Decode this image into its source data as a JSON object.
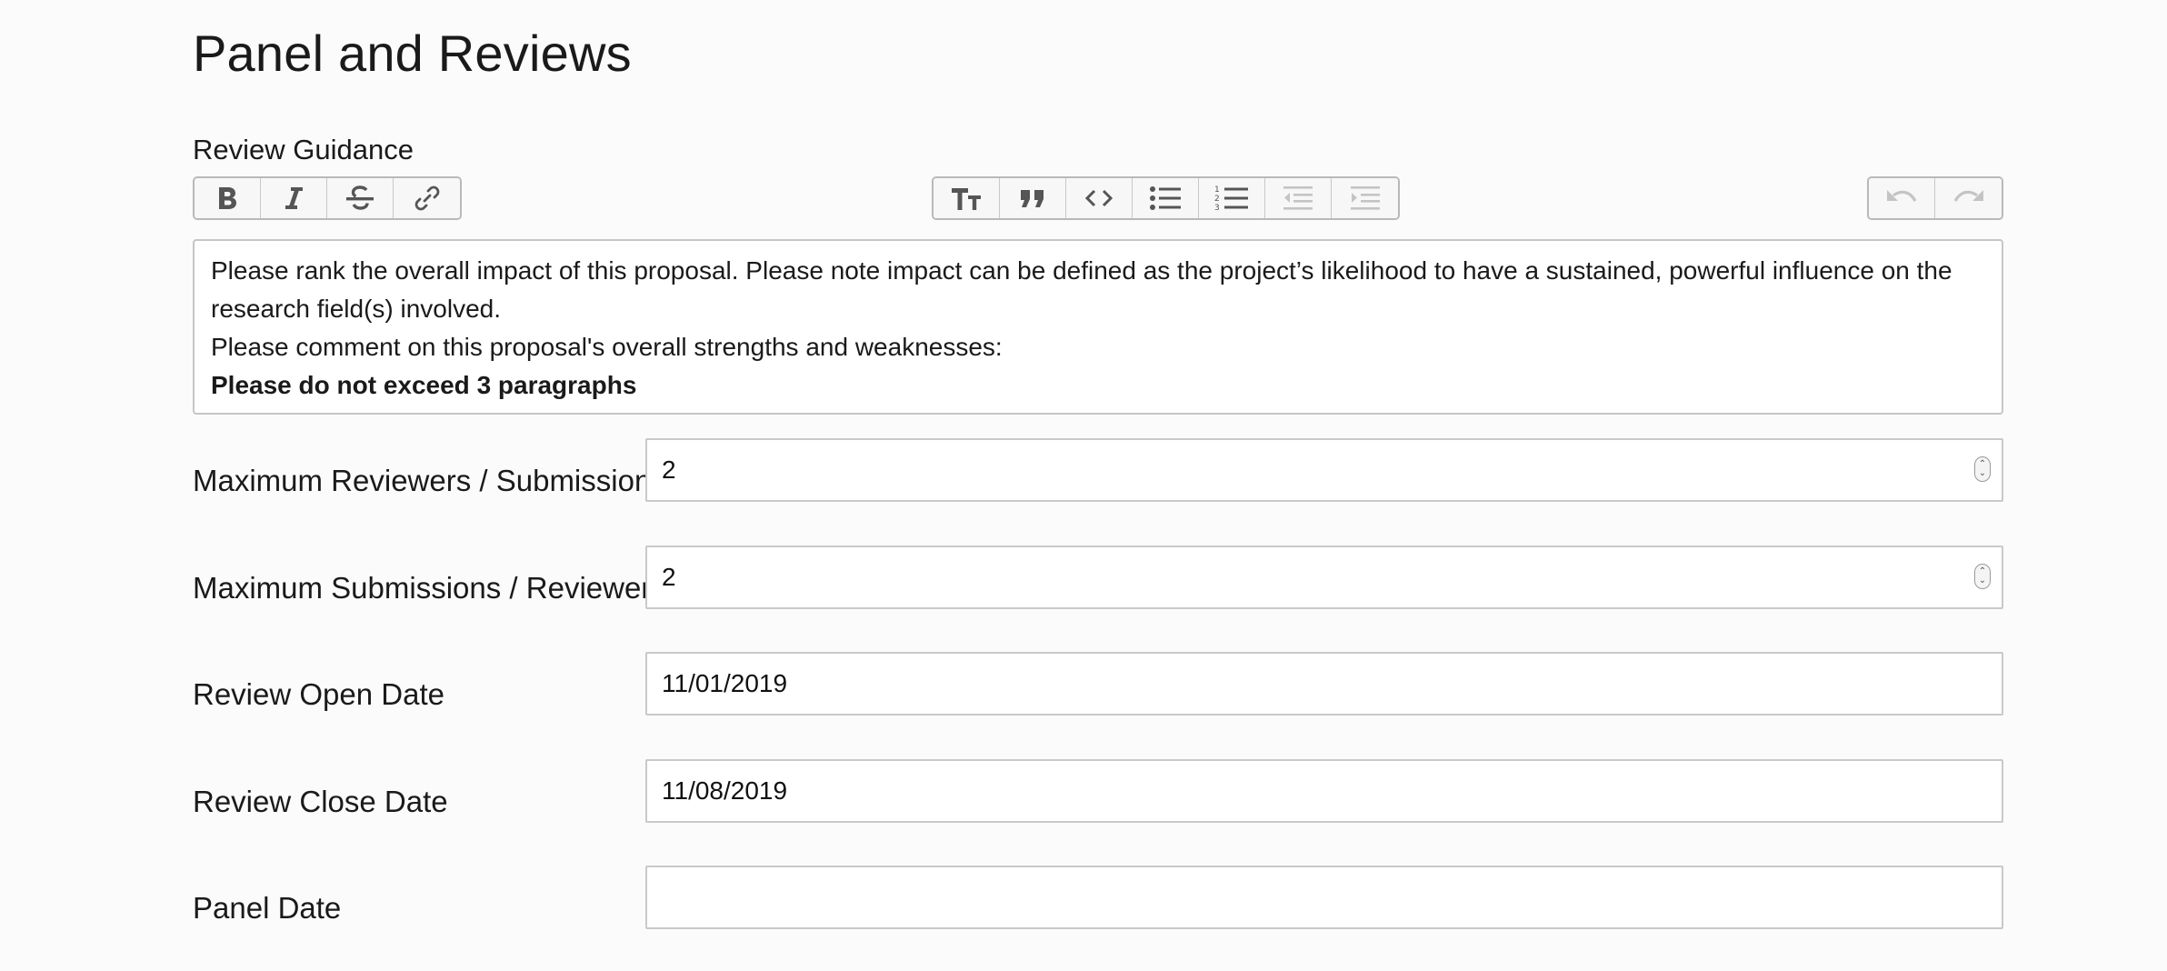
{
  "page": {
    "title": "Panel and Reviews"
  },
  "review_guidance": {
    "label": "Review Guidance",
    "toolbar": {
      "left": [
        "bold-icon",
        "italic-icon",
        "strikethrough-icon",
        "link-icon"
      ],
      "middle": [
        "heading-icon",
        "quote-icon",
        "code-icon",
        "bullet-list-icon",
        "numbered-list-icon",
        "outdent-icon",
        "indent-icon"
      ],
      "right": [
        "undo-icon",
        "redo-icon"
      ],
      "disabled": [
        "outdent-icon",
        "indent-icon",
        "undo-icon",
        "redo-icon"
      ]
    },
    "content": {
      "p1": "Please rank the overall impact of this proposal. Please note impact can be defined as the project’s likelihood to have a sustained, powerful influence on the research field(s) involved.",
      "p2": "Please comment on this proposal's overall strengths and weaknesses:",
      "p3": "Please do not exceed 3 paragraphs"
    }
  },
  "form": {
    "max_reviewers": {
      "label": "Maximum Reviewers / Submission",
      "value": "2"
    },
    "max_submissions": {
      "label": "Maximum Submissions / Reviewer",
      "value": "2"
    },
    "review_open_date": {
      "label": "Review Open Date",
      "value": "11/01/2019"
    },
    "review_close_date": {
      "label": "Review Close Date",
      "value": "11/08/2019"
    },
    "panel_date": {
      "label": "Panel Date",
      "value": ""
    }
  },
  "colors": {
    "icon_active": "#555555",
    "icon_disabled": "#c4c4c4",
    "border": "#c6c6c6"
  }
}
